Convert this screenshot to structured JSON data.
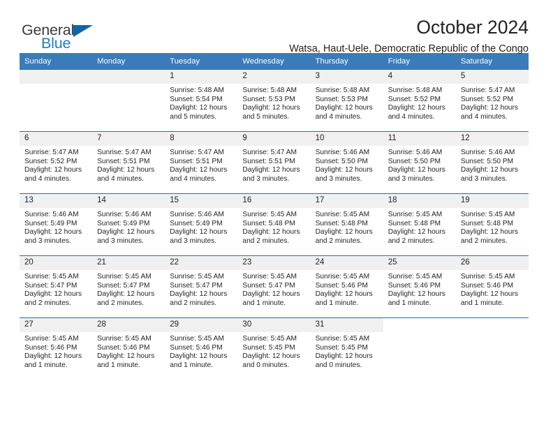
{
  "brand": {
    "line1": "General",
    "line2": "Blue",
    "triangle_icon": "triangle-icon",
    "color_dark": "#3b3b3b",
    "color_blue": "#1c7fc4",
    "triangle_color": "#1064a8"
  },
  "header": {
    "title": "October 2024",
    "subtitle": "Watsa, Haut-Uele, Democratic Republic of the Congo"
  },
  "theme": {
    "header_bg": "#3a7cba",
    "header_text": "#ffffff",
    "row_border": "#2d6ca8",
    "daynum_bg": "#f0f0f0",
    "body_text": "#231f20"
  },
  "weekday_headers": [
    "Sunday",
    "Monday",
    "Tuesday",
    "Wednesday",
    "Thursday",
    "Friday",
    "Saturday"
  ],
  "weeks": [
    [
      {
        "day": "",
        "empty": true
      },
      {
        "day": "",
        "empty": true
      },
      {
        "day": "1",
        "sunrise": "Sunrise: 5:48 AM",
        "sunset": "Sunset: 5:54 PM",
        "daylight_line1": "Daylight: 12 hours",
        "daylight_line2": "and 5 minutes."
      },
      {
        "day": "2",
        "sunrise": "Sunrise: 5:48 AM",
        "sunset": "Sunset: 5:53 PM",
        "daylight_line1": "Daylight: 12 hours",
        "daylight_line2": "and 5 minutes."
      },
      {
        "day": "3",
        "sunrise": "Sunrise: 5:48 AM",
        "sunset": "Sunset: 5:53 PM",
        "daylight_line1": "Daylight: 12 hours",
        "daylight_line2": "and 4 minutes."
      },
      {
        "day": "4",
        "sunrise": "Sunrise: 5:48 AM",
        "sunset": "Sunset: 5:52 PM",
        "daylight_line1": "Daylight: 12 hours",
        "daylight_line2": "and 4 minutes."
      },
      {
        "day": "5",
        "sunrise": "Sunrise: 5:47 AM",
        "sunset": "Sunset: 5:52 PM",
        "daylight_line1": "Daylight: 12 hours",
        "daylight_line2": "and 4 minutes."
      }
    ],
    [
      {
        "day": "6",
        "sunrise": "Sunrise: 5:47 AM",
        "sunset": "Sunset: 5:52 PM",
        "daylight_line1": "Daylight: 12 hours",
        "daylight_line2": "and 4 minutes."
      },
      {
        "day": "7",
        "sunrise": "Sunrise: 5:47 AM",
        "sunset": "Sunset: 5:51 PM",
        "daylight_line1": "Daylight: 12 hours",
        "daylight_line2": "and 4 minutes."
      },
      {
        "day": "8",
        "sunrise": "Sunrise: 5:47 AM",
        "sunset": "Sunset: 5:51 PM",
        "daylight_line1": "Daylight: 12 hours",
        "daylight_line2": "and 4 minutes."
      },
      {
        "day": "9",
        "sunrise": "Sunrise: 5:47 AM",
        "sunset": "Sunset: 5:51 PM",
        "daylight_line1": "Daylight: 12 hours",
        "daylight_line2": "and 3 minutes."
      },
      {
        "day": "10",
        "sunrise": "Sunrise: 5:46 AM",
        "sunset": "Sunset: 5:50 PM",
        "daylight_line1": "Daylight: 12 hours",
        "daylight_line2": "and 3 minutes."
      },
      {
        "day": "11",
        "sunrise": "Sunrise: 5:46 AM",
        "sunset": "Sunset: 5:50 PM",
        "daylight_line1": "Daylight: 12 hours",
        "daylight_line2": "and 3 minutes."
      },
      {
        "day": "12",
        "sunrise": "Sunrise: 5:46 AM",
        "sunset": "Sunset: 5:50 PM",
        "daylight_line1": "Daylight: 12 hours",
        "daylight_line2": "and 3 minutes."
      }
    ],
    [
      {
        "day": "13",
        "sunrise": "Sunrise: 5:46 AM",
        "sunset": "Sunset: 5:49 PM",
        "daylight_line1": "Daylight: 12 hours",
        "daylight_line2": "and 3 minutes."
      },
      {
        "day": "14",
        "sunrise": "Sunrise: 5:46 AM",
        "sunset": "Sunset: 5:49 PM",
        "daylight_line1": "Daylight: 12 hours",
        "daylight_line2": "and 3 minutes."
      },
      {
        "day": "15",
        "sunrise": "Sunrise: 5:46 AM",
        "sunset": "Sunset: 5:49 PM",
        "daylight_line1": "Daylight: 12 hours",
        "daylight_line2": "and 3 minutes."
      },
      {
        "day": "16",
        "sunrise": "Sunrise: 5:45 AM",
        "sunset": "Sunset: 5:48 PM",
        "daylight_line1": "Daylight: 12 hours",
        "daylight_line2": "and 2 minutes."
      },
      {
        "day": "17",
        "sunrise": "Sunrise: 5:45 AM",
        "sunset": "Sunset: 5:48 PM",
        "daylight_line1": "Daylight: 12 hours",
        "daylight_line2": "and 2 minutes."
      },
      {
        "day": "18",
        "sunrise": "Sunrise: 5:45 AM",
        "sunset": "Sunset: 5:48 PM",
        "daylight_line1": "Daylight: 12 hours",
        "daylight_line2": "and 2 minutes."
      },
      {
        "day": "19",
        "sunrise": "Sunrise: 5:45 AM",
        "sunset": "Sunset: 5:48 PM",
        "daylight_line1": "Daylight: 12 hours",
        "daylight_line2": "and 2 minutes."
      }
    ],
    [
      {
        "day": "20",
        "sunrise": "Sunrise: 5:45 AM",
        "sunset": "Sunset: 5:47 PM",
        "daylight_line1": "Daylight: 12 hours",
        "daylight_line2": "and 2 minutes."
      },
      {
        "day": "21",
        "sunrise": "Sunrise: 5:45 AM",
        "sunset": "Sunset: 5:47 PM",
        "daylight_line1": "Daylight: 12 hours",
        "daylight_line2": "and 2 minutes."
      },
      {
        "day": "22",
        "sunrise": "Sunrise: 5:45 AM",
        "sunset": "Sunset: 5:47 PM",
        "daylight_line1": "Daylight: 12 hours",
        "daylight_line2": "and 2 minutes."
      },
      {
        "day": "23",
        "sunrise": "Sunrise: 5:45 AM",
        "sunset": "Sunset: 5:47 PM",
        "daylight_line1": "Daylight: 12 hours",
        "daylight_line2": "and 1 minute."
      },
      {
        "day": "24",
        "sunrise": "Sunrise: 5:45 AM",
        "sunset": "Sunset: 5:46 PM",
        "daylight_line1": "Daylight: 12 hours",
        "daylight_line2": "and 1 minute."
      },
      {
        "day": "25",
        "sunrise": "Sunrise: 5:45 AM",
        "sunset": "Sunset: 5:46 PM",
        "daylight_line1": "Daylight: 12 hours",
        "daylight_line2": "and 1 minute."
      },
      {
        "day": "26",
        "sunrise": "Sunrise: 5:45 AM",
        "sunset": "Sunset: 5:46 PM",
        "daylight_line1": "Daylight: 12 hours",
        "daylight_line2": "and 1 minute."
      }
    ],
    [
      {
        "day": "27",
        "sunrise": "Sunrise: 5:45 AM",
        "sunset": "Sunset: 5:46 PM",
        "daylight_line1": "Daylight: 12 hours",
        "daylight_line2": "and 1 minute."
      },
      {
        "day": "28",
        "sunrise": "Sunrise: 5:45 AM",
        "sunset": "Sunset: 5:46 PM",
        "daylight_line1": "Daylight: 12 hours",
        "daylight_line2": "and 1 minute."
      },
      {
        "day": "29",
        "sunrise": "Sunrise: 5:45 AM",
        "sunset": "Sunset: 5:46 PM",
        "daylight_line1": "Daylight: 12 hours",
        "daylight_line2": "and 1 minute."
      },
      {
        "day": "30",
        "sunrise": "Sunrise: 5:45 AM",
        "sunset": "Sunset: 5:45 PM",
        "daylight_line1": "Daylight: 12 hours",
        "daylight_line2": "and 0 minutes."
      },
      {
        "day": "31",
        "sunrise": "Sunrise: 5:45 AM",
        "sunset": "Sunset: 5:45 PM",
        "daylight_line1": "Daylight: 12 hours",
        "daylight_line2": "and 0 minutes."
      },
      {
        "day": "",
        "blank": true
      },
      {
        "day": "",
        "blank": true
      }
    ]
  ]
}
